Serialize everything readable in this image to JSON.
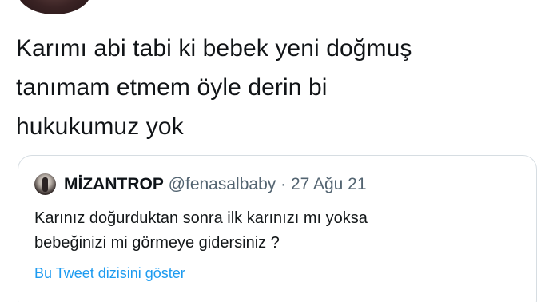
{
  "tweet": {
    "lines": [
      "Karımı abi tabi ki bebek yeni doğmuş",
      "tanımam etmem öyle derin bi",
      "hukukumuz yok"
    ]
  },
  "quoted_tweet": {
    "name": "MİZANTROP",
    "handle": "@fenasalbaby",
    "separator": "·",
    "date": "27 Ağu 21",
    "lines": [
      "Karınız doğurduktan sonra ilk karınızı mı yoksa",
      "bebeğinizi mi görmeye gidersiniz ?"
    ],
    "show_thread": "Bu Tweet dizisini göster"
  },
  "colors": {
    "link": "#1d9bf0",
    "secondary_text": "#536471",
    "border": "#d6dde2"
  }
}
